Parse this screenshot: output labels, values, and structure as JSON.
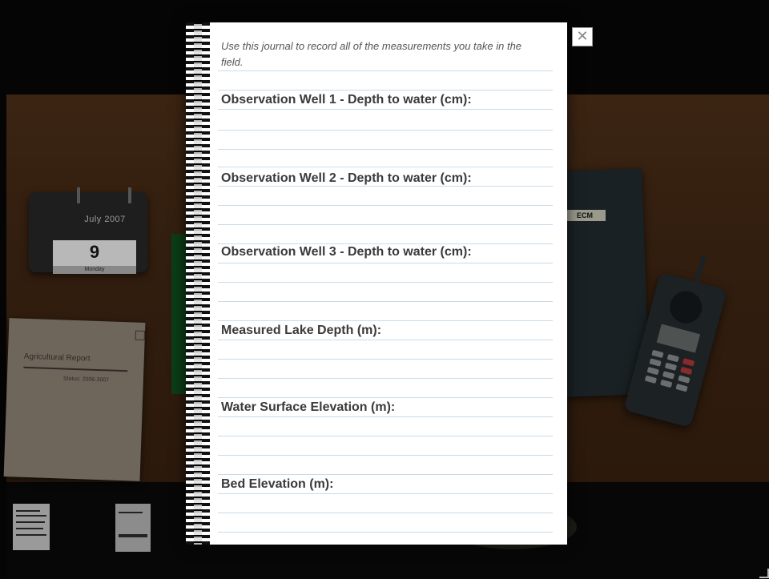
{
  "background": {
    "calendar": {
      "month": "July 2007",
      "day": "9",
      "weekday": "Monday"
    },
    "report": {
      "title": "Agricultural Report",
      "subtitle": "Status: 2006-2007"
    },
    "book_tag": "ECM"
  },
  "journal": {
    "intro": "Use this journal to record all of the measurements you take in the field.",
    "close_symbol": "✕",
    "fields": [
      {
        "label": "Observation Well 1 - Depth to water (cm):"
      },
      {
        "label": "Observation Well 2 - Depth to water (cm):"
      },
      {
        "label": "Observation Well 3 - Depth to water (cm):"
      },
      {
        "label": "Measured Lake Depth (m):"
      },
      {
        "label": "Water Surface Elevation (m):"
      },
      {
        "label": "Bed Elevation (m):"
      }
    ]
  }
}
